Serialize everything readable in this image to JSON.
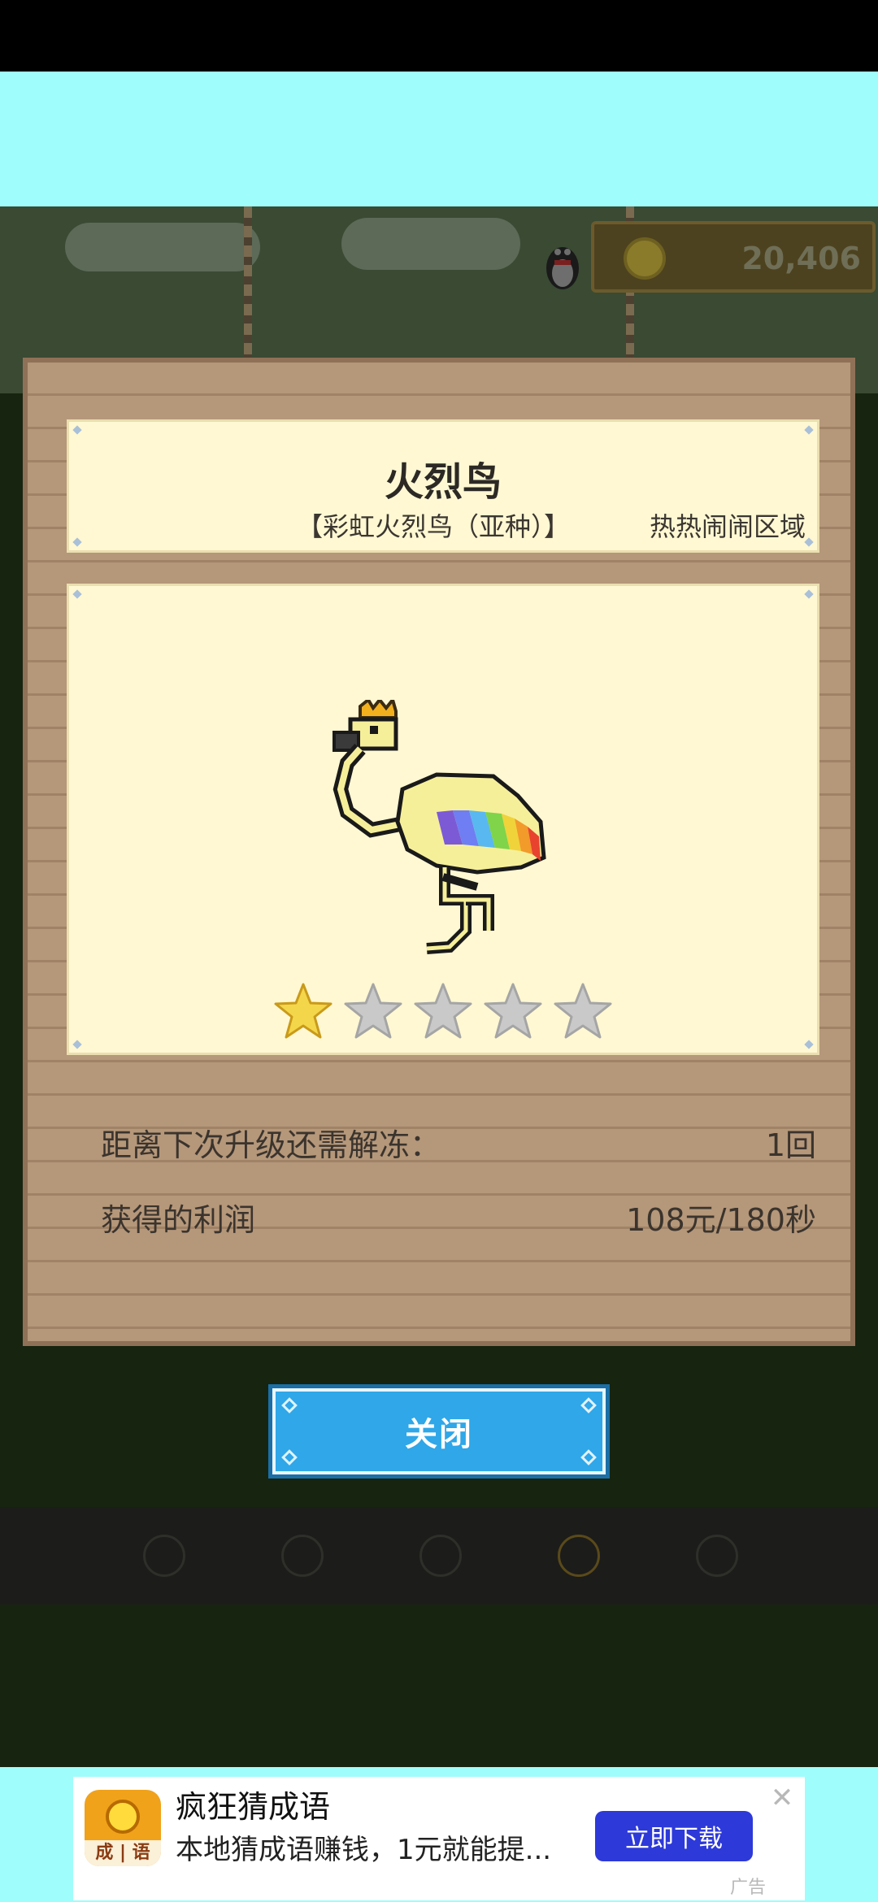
{
  "game": {
    "coins": "20,406"
  },
  "modal": {
    "animal_name": "火烈鸟",
    "animal_variant": "【彩虹火烈鸟（亚种）】",
    "animal_region": "热热闹闹区域",
    "stars_total": 5,
    "stars_filled": 1,
    "stats": [
      {
        "label": "距离下次升级还需解冻：",
        "value": "1回"
      },
      {
        "label": "获得的利润",
        "value": "108元/180秒"
      }
    ],
    "close_label": "关闭"
  },
  "ad": {
    "icon_text": "成 | 语",
    "title": "疯狂猜成语",
    "description": "本地猜成语赚钱，1元就能提...",
    "button_label": "立即下载",
    "close_symbol": "✕",
    "ad_label": "广告"
  },
  "colors": {
    "board": "#b5977a",
    "panel": "#fff8d3",
    "close_button": "#2fa7e8",
    "ad_button": "#2d39d8",
    "star_filled": "#f4d64a",
    "star_empty": "#c9c9c9"
  }
}
